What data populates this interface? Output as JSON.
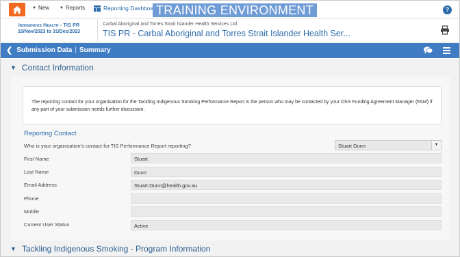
{
  "topbar": {
    "home_icon": "home-icon",
    "new_label": "New",
    "reports_label": "Reports",
    "dashboard_label": "Reporting Dashboard",
    "environment_banner": "TRAINING ENVIRONMENT",
    "help_icon": "?"
  },
  "report": {
    "program_line": "Indigenous Health - TIS PR",
    "period_line": "15/Nov/2023 to 31/Dec/2023",
    "org_name": "Carbal Aboriginal and Torres Strait Islander Health Services Ltd",
    "title": "TIS PR - Carbal Aboriginal and Torres Strait Islander Health Ser..."
  },
  "nav": {
    "back_label": "Submission Data",
    "separator": "|",
    "current_label": "Summary"
  },
  "contact": {
    "section_title": "Contact Information",
    "info_text": "The reporting contact for your organisation for the Tackling Indigenous Smoking Performance Report is the person who may be contacted by your DSS Funding Agreement Manager (FAM) if any part of your submission needs further discussion.",
    "subheader": "Reporting Contact",
    "question": "Who is your organisation's contact for TIS Performance Report reporting?",
    "selected_contact": "Stuart Dunn",
    "fields": [
      {
        "label": "First Name",
        "value": "Stuart"
      },
      {
        "label": "Last Name",
        "value": "Dunn"
      },
      {
        "label": "Email Address",
        "value": "Stuart.Dunn@health.gov.au"
      },
      {
        "label": "Phone",
        "value": ""
      },
      {
        "label": "Mobile",
        "value": ""
      },
      {
        "label": "Current User Status",
        "value": "Active"
      }
    ]
  },
  "next_section": {
    "title": "Tackling Indigenous Smoking - Program Information"
  },
  "colors": {
    "accent": "#3f7cc4",
    "home": "#f26a21",
    "link": "#2a6aab"
  }
}
